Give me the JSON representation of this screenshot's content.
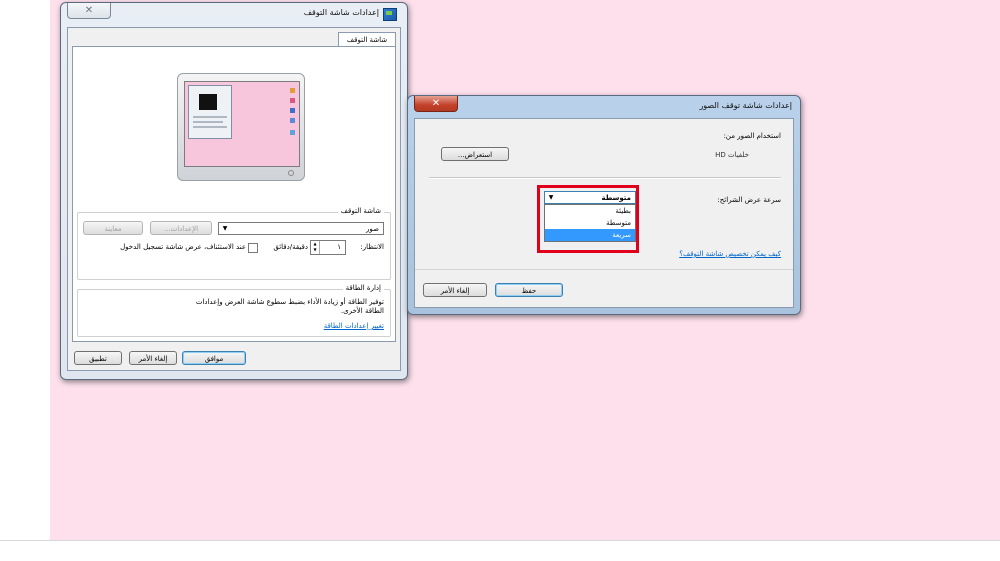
{
  "screensaver_window": {
    "title": "إعدادات شاشة التوقف",
    "close_label": "✕",
    "tab_label": "شاشة التوقف",
    "screensaver_group_title": "شاشة التوقف",
    "screensaver_selected": "صور",
    "settings_button": "الإعدادات...",
    "preview_button": "معاينة",
    "wait_label": "الانتظار:",
    "wait_value": "١",
    "wait_unit": "دقيقة/دقائق",
    "resume_label": "عند الاستئناف، عرض شاشة تسجيل الدخول",
    "power_group_title": "إدارة الطاقة",
    "power_text": "توفير الطاقة أو زيادة الأداء بضبط سطوع شاشة العرض وإعدادات الطاقة الأخرى.",
    "power_link": "تغيير إعدادات الطاقة",
    "ok_button": "موافق",
    "cancel_button": "إلغاء الأمر",
    "apply_button": "تطبيق"
  },
  "photos_window": {
    "title": "إعدادات شاشة توقف الصور",
    "close_label": "✕",
    "use_photos_label": "استخدام الصور من:",
    "source_value": "خلفيات HD",
    "browse_button": "استعراض...",
    "speed_label": "سرعة عرض الشرائح:",
    "speed_selected": "متوسطة",
    "speed_options": [
      "بطيئة",
      "متوسطة",
      "سريعة"
    ],
    "help_link": "كيف يمكن تخصيص شاشة التوقف؟",
    "save_button": "حفظ",
    "cancel_button": "إلغاء الأمر"
  },
  "colors": {
    "desktop": "#fde0ec",
    "highlight": "#3399ff",
    "callout": "#e0001b"
  }
}
